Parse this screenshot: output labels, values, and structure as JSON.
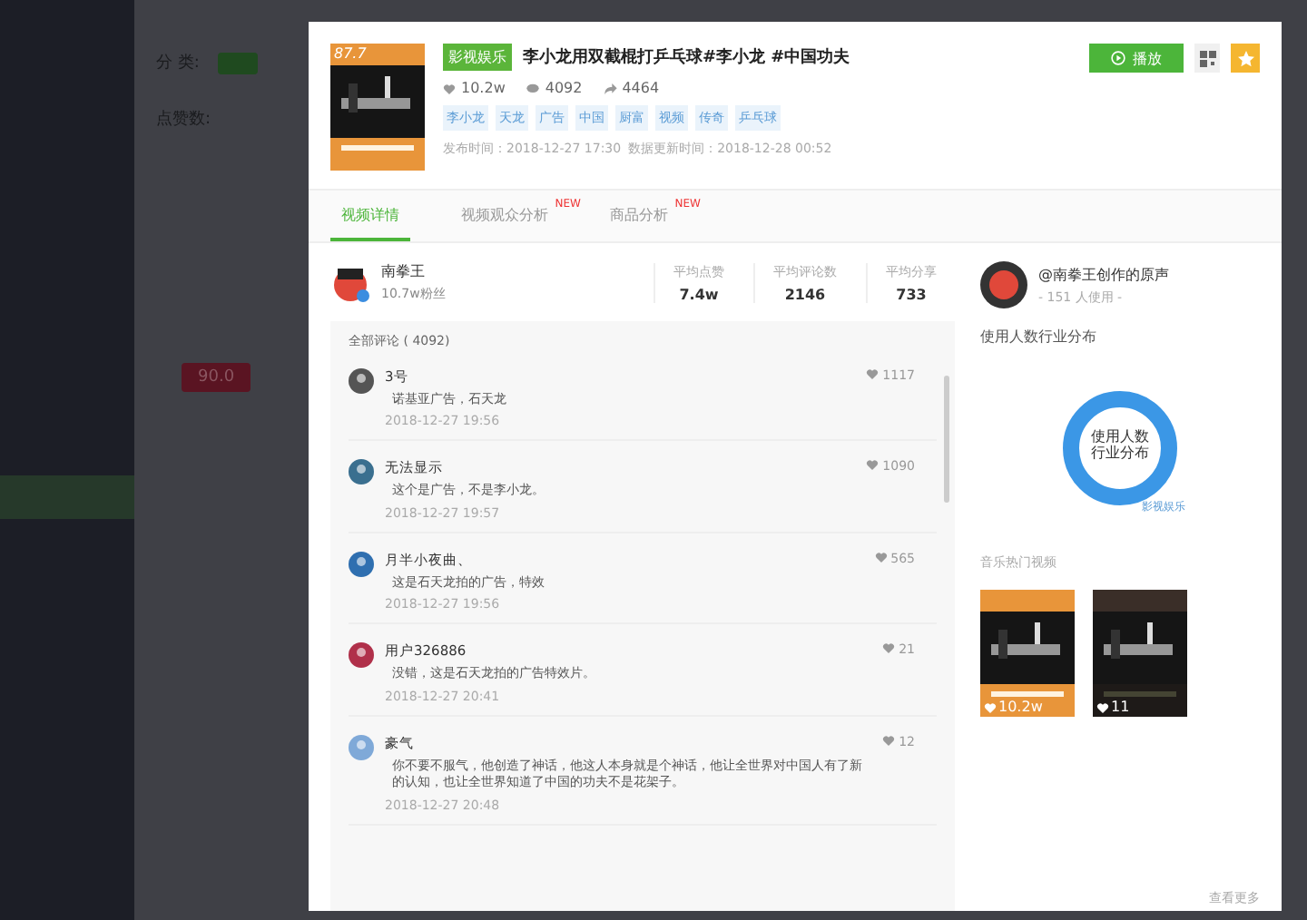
{
  "background": {
    "filter_label": "分 类:",
    "likes_label": "点赞数:",
    "score": "90.0"
  },
  "video": {
    "score": "87.7",
    "category": "影视娱乐",
    "title": "李小龙用双截棍打乒乓球#李小龙 #中国功夫",
    "likes": "10.2w",
    "comments": "4092",
    "shares": "4464",
    "tags": [
      "李小龙",
      "天龙",
      "广告",
      "中国",
      "厨富",
      "视频",
      "传奇",
      "乒乓球"
    ],
    "published": "发布时间：2018-12-27 17:30",
    "updated": "数据更新时间：2018-12-28 00:52",
    "play_button": "播放"
  },
  "tabs": [
    {
      "label": "视频详情",
      "selected": true
    },
    {
      "label": "视频观众分析",
      "selected": false,
      "badge": "NEW"
    },
    {
      "label": "商品分析",
      "selected": false,
      "badge": "NEW"
    }
  ],
  "author": {
    "name": "南拳王",
    "fans": "10.7w粉丝"
  },
  "averages": [
    {
      "label": "平均点赞",
      "value": "7.4w"
    },
    {
      "label": "平均评论数",
      "value": "2146"
    },
    {
      "label": "平均分享",
      "value": "733"
    }
  ],
  "comments": {
    "heading": "全部评论",
    "count": "( 4092)",
    "items": [
      {
        "user": "3号",
        "text": "诺基亚广告，石天龙",
        "time": "2018-12-27 19:56",
        "likes": "1117"
      },
      {
        "user": "无法显示",
        "text": "这个是广告，不是李小龙。",
        "time": "2018-12-27 19:57",
        "likes": "1090"
      },
      {
        "user": "月半小夜曲、",
        "text": "这是石天龙拍的广告，特效",
        "time": "2018-12-27 19:56",
        "likes": "565"
      },
      {
        "user": "用户326886",
        "text": "没错，这是石天龙拍的广告特效片。",
        "time": "2018-12-27 20:41",
        "likes": "21"
      },
      {
        "user": "豪气",
        "text": "你不要不服气，他创造了神话，他这人本身就是个神话，他让全世界对中国人有了新的认知，也让全世界知道了中国的功夫不是花架子。",
        "time": "2018-12-27 20:48",
        "likes": "12"
      }
    ]
  },
  "music": {
    "title": "@南拳王创作的原声",
    "usage": "- 151 人使用 -",
    "industry_heading": "使用人数行业分布",
    "donut_center": [
      "使用人数",
      "行业分布"
    ],
    "donut_label": "影视娱乐",
    "hot_heading": "音乐热门视频",
    "videos": [
      {
        "likes": "10.2w"
      },
      {
        "likes": "11"
      }
    ],
    "more": "查看更多"
  }
}
